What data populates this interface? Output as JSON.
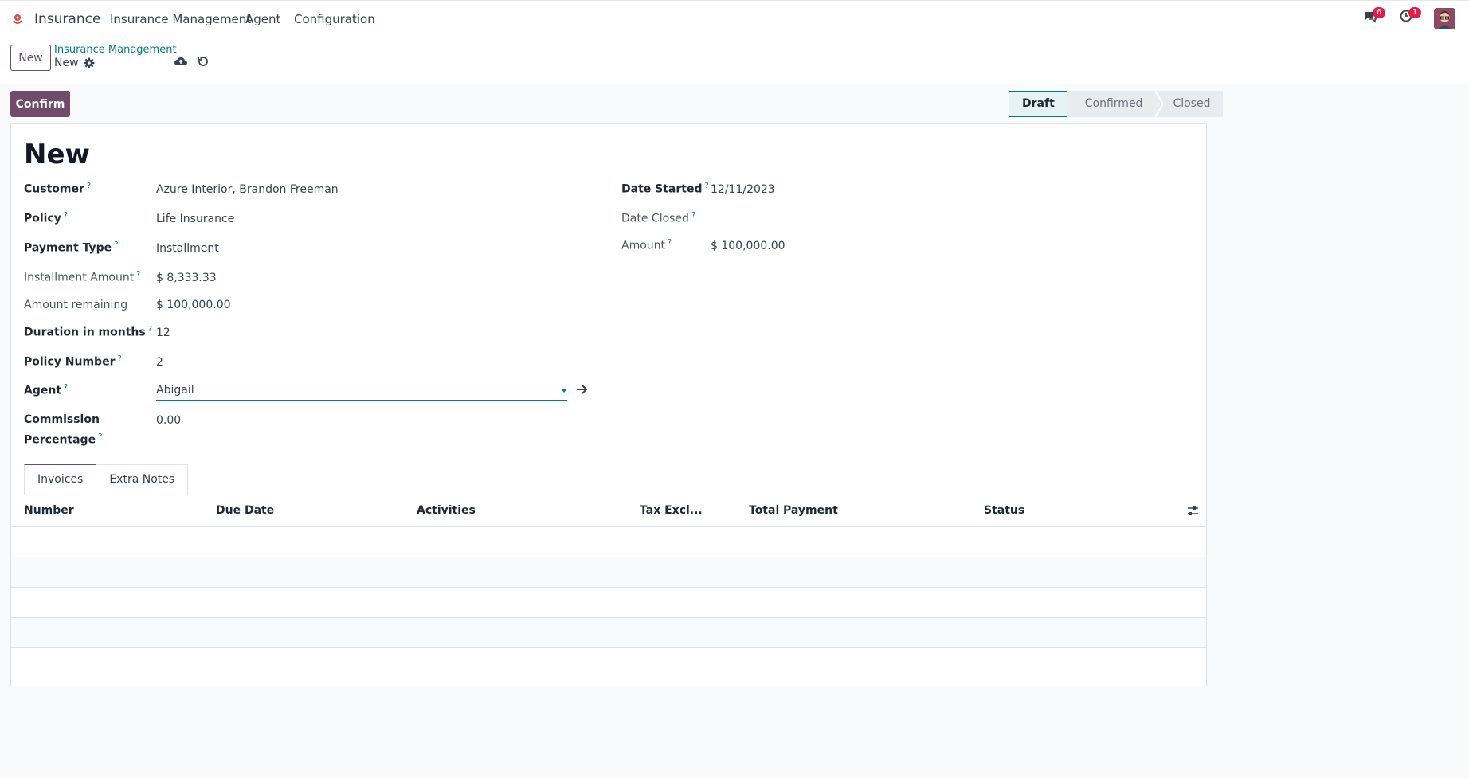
{
  "nav": {
    "app_name": "Insurance",
    "menu": [
      "Insurance Management",
      "Agent",
      "Configuration"
    ],
    "messages_count": "6",
    "activities_count": "1"
  },
  "control_panel": {
    "new_button": "New",
    "breadcrumb_parent": "Insurance Management",
    "breadcrumb_current": "New"
  },
  "header": {
    "confirm_button": "Confirm",
    "stages": [
      "Draft",
      "Confirmed",
      "Closed"
    ],
    "active_stage": "Draft"
  },
  "form": {
    "title": "New",
    "left_fields": [
      {
        "label": "Customer",
        "help": "?",
        "value": "Azure Interior, Brandon Freeman"
      },
      {
        "label": "Policy",
        "help": "?",
        "value": "Life Insurance"
      },
      {
        "label": "Payment Type",
        "help": "?",
        "value": "Installment"
      },
      {
        "label": "Installment Amount",
        "help": "?",
        "value": "$ 8,333.33"
      },
      {
        "label": "Amount remaining",
        "help": "",
        "value": "$ 100,000.00"
      },
      {
        "label": "Duration in months",
        "help": "?",
        "value": "12"
      },
      {
        "label": "Policy Number",
        "help": "?",
        "value": "2"
      },
      {
        "label": "Agent",
        "help": "?",
        "value": "Abigail"
      },
      {
        "label_line1": "Commission",
        "label_line2": "Percentage",
        "help": "?",
        "value": "0.00"
      }
    ],
    "right_fields": [
      {
        "label": "Date Started",
        "help": "?",
        "value": "12/11/2023"
      },
      {
        "label": "Date Closed",
        "help": "?",
        "value": ""
      },
      {
        "label": "Amount",
        "help": "?",
        "value": "$ 100,000.00"
      }
    ]
  },
  "tabs": [
    "Invoices",
    "Extra Notes"
  ],
  "invoices_table": {
    "columns": [
      "Number",
      "Due Date",
      "Activities",
      "Tax Excl...",
      "Total",
      "Payment",
      "Status"
    ],
    "rows": []
  },
  "colors": {
    "brand": "#714b67",
    "accent": "#017e84"
  }
}
